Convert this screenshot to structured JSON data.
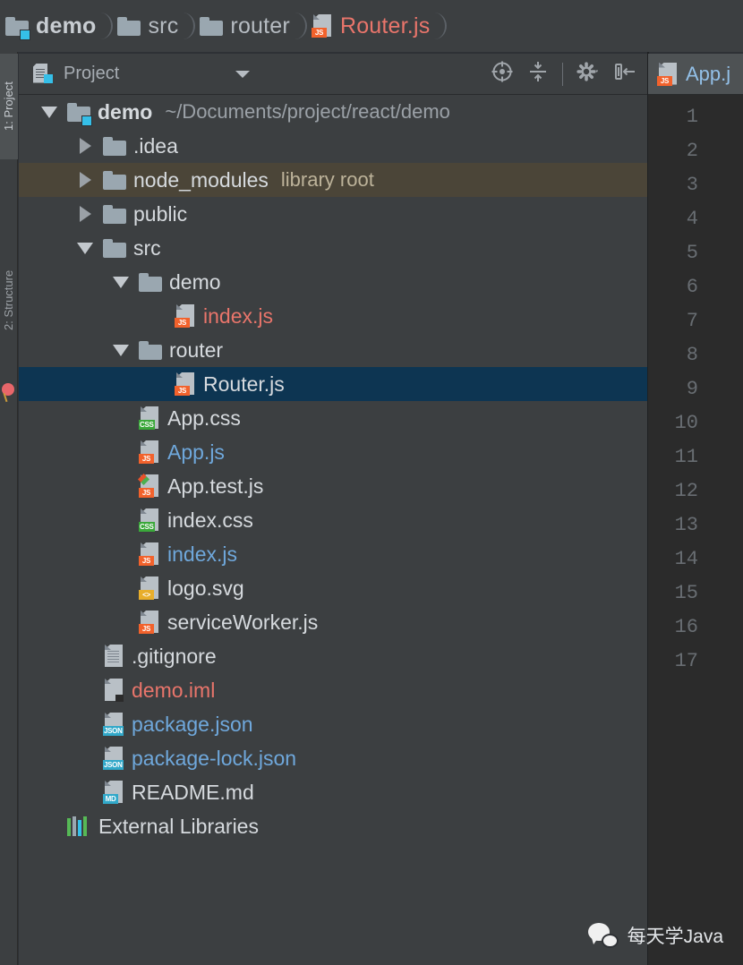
{
  "breadcrumb": {
    "name": "breadcrumb",
    "items": [
      {
        "label": "demo",
        "icon": "folder-module-icon",
        "style": "bold"
      },
      {
        "label": "src",
        "icon": "folder-icon",
        "style": "plain"
      },
      {
        "label": "router",
        "icon": "folder-icon",
        "style": "plain"
      },
      {
        "label": "Router.js",
        "icon": "js-file-icon",
        "style": "js"
      }
    ]
  },
  "toolwindow_tabs": [
    {
      "label": "1: Project",
      "active": true
    },
    {
      "label": "2: Structure",
      "active": false
    }
  ],
  "panel": {
    "title": "Project",
    "icon": "project-view-icon",
    "caret": "chevron-down-icon",
    "tools": [
      {
        "name": "locate-in-tree-icon",
        "tooltip": "Select Opened File"
      },
      {
        "name": "collapse-all-icon",
        "tooltip": "Collapse All"
      },
      {
        "name": "settings-gear-icon",
        "tooltip": "Settings"
      },
      {
        "name": "hide-panel-icon",
        "tooltip": "Hide"
      }
    ]
  },
  "tree": {
    "rows": [
      {
        "label": "demo",
        "hint": "~/Documents/project/react/demo",
        "depth": 0,
        "arrow": "expanded",
        "icon": "folder-module-icon",
        "color": "bold",
        "selected": false,
        "highlight": false
      },
      {
        "label": ".idea",
        "hint": "",
        "depth": 1,
        "arrow": "collapsed",
        "icon": "folder-icon",
        "color": "white",
        "selected": false,
        "highlight": false
      },
      {
        "label": "node_modules",
        "hint": "library root",
        "depth": 1,
        "arrow": "collapsed",
        "icon": "folder-icon",
        "color": "white",
        "selected": false,
        "highlight": true
      },
      {
        "label": "public",
        "hint": "",
        "depth": 1,
        "arrow": "collapsed",
        "icon": "folder-icon",
        "color": "white",
        "selected": false,
        "highlight": false
      },
      {
        "label": "src",
        "hint": "",
        "depth": 1,
        "arrow": "expanded",
        "icon": "folder-icon",
        "color": "white",
        "selected": false,
        "highlight": false
      },
      {
        "label": "demo",
        "hint": "",
        "depth": 2,
        "arrow": "expanded",
        "icon": "folder-icon",
        "color": "white",
        "selected": false,
        "highlight": false
      },
      {
        "label": "index.js",
        "hint": "",
        "depth": 3,
        "arrow": "none",
        "icon": "js-file-icon",
        "color": "js",
        "selected": false,
        "highlight": false
      },
      {
        "label": "router",
        "hint": "",
        "depth": 2,
        "arrow": "expanded",
        "icon": "folder-icon",
        "color": "white",
        "selected": false,
        "highlight": false
      },
      {
        "label": "Router.js",
        "hint": "",
        "depth": 3,
        "arrow": "none",
        "icon": "js-file-icon",
        "color": "white",
        "selected": true,
        "highlight": false
      },
      {
        "label": "App.css",
        "hint": "",
        "depth": 2,
        "arrow": "none",
        "icon": "css-file-icon",
        "color": "white",
        "selected": false,
        "highlight": false
      },
      {
        "label": "App.js",
        "hint": "",
        "depth": 2,
        "arrow": "none",
        "icon": "js-file-icon",
        "color": "blue",
        "selected": false,
        "highlight": false
      },
      {
        "label": "App.test.js",
        "hint": "",
        "depth": 2,
        "arrow": "none",
        "icon": "js-test-file-icon",
        "color": "white",
        "selected": false,
        "highlight": false
      },
      {
        "label": "index.css",
        "hint": "",
        "depth": 2,
        "arrow": "none",
        "icon": "css-file-icon",
        "color": "white",
        "selected": false,
        "highlight": false
      },
      {
        "label": "index.js",
        "hint": "",
        "depth": 2,
        "arrow": "none",
        "icon": "js-file-icon",
        "color": "blue",
        "selected": false,
        "highlight": false
      },
      {
        "label": "logo.svg",
        "hint": "",
        "depth": 2,
        "arrow": "none",
        "icon": "svg-file-icon",
        "color": "white",
        "selected": false,
        "highlight": false
      },
      {
        "label": "serviceWorker.js",
        "hint": "",
        "depth": 2,
        "arrow": "none",
        "icon": "js-file-icon",
        "color": "white",
        "selected": false,
        "highlight": false
      },
      {
        "label": ".gitignore",
        "hint": "",
        "depth": 1,
        "arrow": "none",
        "icon": "text-file-icon",
        "color": "white",
        "selected": false,
        "highlight": false
      },
      {
        "label": "demo.iml",
        "hint": "",
        "depth": 1,
        "arrow": "none",
        "icon": "iml-file-icon",
        "color": "red",
        "selected": false,
        "highlight": false
      },
      {
        "label": "package.json",
        "hint": "",
        "depth": 1,
        "arrow": "none",
        "icon": "json-file-icon",
        "color": "blue",
        "selected": false,
        "highlight": false
      },
      {
        "label": "package-lock.json",
        "hint": "",
        "depth": 1,
        "arrow": "none",
        "icon": "json-file-icon",
        "color": "blue",
        "selected": false,
        "highlight": false
      },
      {
        "label": "README.md",
        "hint": "",
        "depth": 1,
        "arrow": "none",
        "icon": "md-file-icon",
        "color": "white",
        "selected": false,
        "highlight": false
      },
      {
        "label": "External Libraries",
        "hint": "",
        "depth": 0,
        "arrow": "none",
        "icon": "external-libraries-icon",
        "color": "white",
        "selected": false,
        "highlight": false
      }
    ]
  },
  "editor": {
    "tab_label": "App.j",
    "tab_icon": "js-file-icon",
    "line_numbers": [
      "1",
      "2",
      "3",
      "4",
      "5",
      "6",
      "7",
      "8",
      "9",
      "10",
      "11",
      "12",
      "13",
      "14",
      "15",
      "16",
      "17"
    ]
  },
  "watermark": {
    "text": "每天学Java",
    "icon": "wechat-icon"
  },
  "colors": {
    "panel_bg": "#3c3f41",
    "editor_bg": "#2b2b2b",
    "selection": "#0d3552",
    "library_root_highlight": "#4b4538",
    "js_badge": "#f2622c",
    "css_badge": "#3aa83a",
    "json_badge": "#31a8c9",
    "svg_badge": "#e8ae2b",
    "module_badge": "#35bfe8",
    "text_default": "#d6dade",
    "text_link": "#6fa8dc",
    "text_js": "#e9756b"
  }
}
